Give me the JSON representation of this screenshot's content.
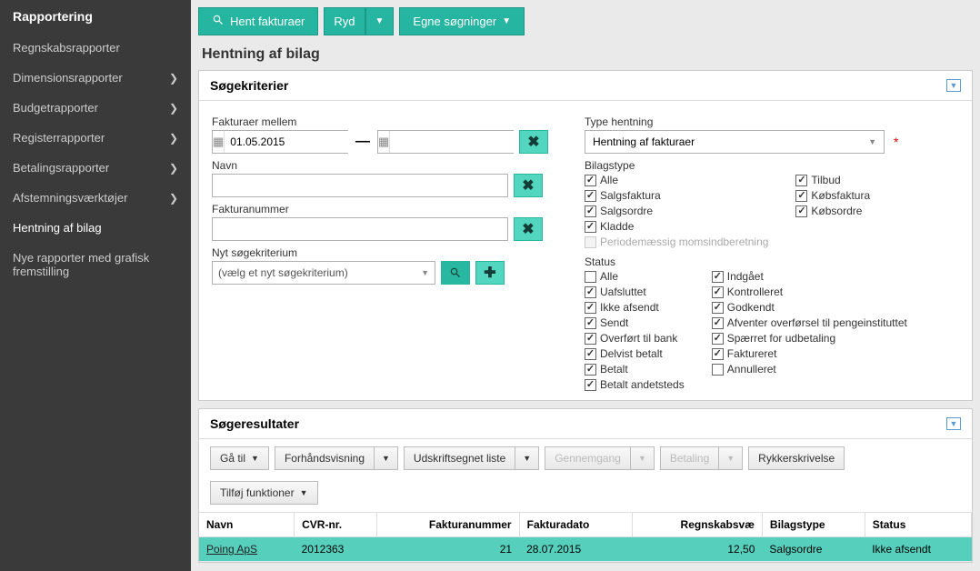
{
  "sidebar": {
    "title": "Rapportering",
    "items": [
      {
        "label": "Regnskabsrapporter",
        "expandable": false
      },
      {
        "label": "Dimensionsrapporter",
        "expandable": true
      },
      {
        "label": "Budgetrapporter",
        "expandable": true
      },
      {
        "label": "Registerrapporter",
        "expandable": true
      },
      {
        "label": "Betalingsrapporter",
        "expandable": true
      },
      {
        "label": "Afstemningsværktøjer",
        "expandable": true
      },
      {
        "label": "Hentning af bilag",
        "expandable": false,
        "active": true
      },
      {
        "label": "Nye rapporter med grafisk fremstilling",
        "expandable": false
      }
    ]
  },
  "toolbar": {
    "fetch": "Hent fakturaer",
    "clear": "Ryd",
    "own_searches": "Egne søgninger"
  },
  "page_title": "Hentning af bilag",
  "criteria": {
    "header": "Søgekriterier",
    "date_label": "Fakturaer mellem",
    "date_from": "01.05.2015",
    "date_to": "",
    "name_label": "Navn",
    "name_value": "",
    "invoice_no_label": "Fakturanummer",
    "invoice_no_value": "",
    "new_crit_label": "Nyt søgekriterium",
    "new_crit_placeholder": "(vælg et nyt søgekriterium)",
    "type_label": "Type hentning",
    "type_value": "Hentning af fakturaer",
    "bilagstype_label": "Bilagstype",
    "bilagstype_left": [
      {
        "label": "Alle",
        "checked": true
      },
      {
        "label": "Salgsfaktura",
        "checked": true
      },
      {
        "label": "Salgsordre",
        "checked": true
      },
      {
        "label": "Kladde",
        "checked": true
      },
      {
        "label": "Periodemæssig momsindberetning",
        "checked": false,
        "disabled": true
      }
    ],
    "bilagstype_right": [
      {
        "label": "Tilbud",
        "checked": true
      },
      {
        "label": "Købsfaktura",
        "checked": true
      },
      {
        "label": "Købsordre",
        "checked": true
      }
    ],
    "status_label": "Status",
    "status_left": [
      {
        "label": "Alle",
        "checked": false
      },
      {
        "label": "Uafsluttet",
        "checked": true
      },
      {
        "label": "Ikke afsendt",
        "checked": true
      },
      {
        "label": "Sendt",
        "checked": true
      },
      {
        "label": "Overført til bank",
        "checked": true
      },
      {
        "label": "Delvist betalt",
        "checked": true
      },
      {
        "label": "Betalt",
        "checked": true
      },
      {
        "label": "Betalt andetsteds",
        "checked": true
      }
    ],
    "status_right": [
      {
        "label": "Indgået",
        "checked": true
      },
      {
        "label": "Kontrolleret",
        "checked": true
      },
      {
        "label": "Godkendt",
        "checked": true
      },
      {
        "label": "Afventer overførsel til pengeinstituttet",
        "checked": true
      },
      {
        "label": "Spærret for udbetaling",
        "checked": true
      },
      {
        "label": "Faktureret",
        "checked": true
      },
      {
        "label": "Annulleret",
        "checked": false
      }
    ]
  },
  "results": {
    "header": "Søgeresultater",
    "goto": "Gå til",
    "preview": "Forhåndsvisning",
    "print_list": "Udskriftsegnet liste",
    "review": "Gennemgang",
    "payment": "Betaling",
    "reminder": "Rykkerskrivelse",
    "add_funcs": "Tilføj funktioner",
    "columns": {
      "name": "Navn",
      "cvr": "CVR-nr.",
      "invoice_no": "Fakturanummer",
      "invoice_date": "Fakturadato",
      "accounting": "Regnskabsvæ",
      "bilagstype": "Bilagstype",
      "status": "Status"
    },
    "rows": [
      {
        "name": "Poing ApS",
        "cvr": "2012363",
        "invoice_no": "21",
        "invoice_date": "28.07.2015",
        "accounting": "12,50",
        "bilagstype": "Salgsordre",
        "status": "Ikke afsendt"
      }
    ]
  }
}
